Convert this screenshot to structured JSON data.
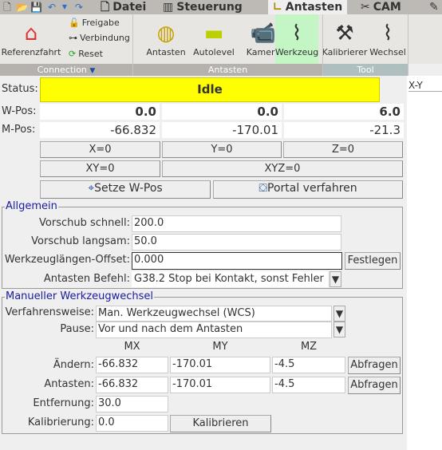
{
  "tabs": [
    {
      "label": "Datei",
      "icon": "document-icon"
    },
    {
      "label": "Steuerung",
      "icon": "sliders-icon"
    },
    {
      "label": "Antasten",
      "icon": "ruler-icon",
      "active": true
    },
    {
      "label": "CAM",
      "icon": "tools-icon"
    }
  ],
  "ribbon": {
    "connection": {
      "group": "Connection",
      "home": "Referenzfahrt",
      "unlock": "Freigabe",
      "connect": "Verbindung",
      "reset": "Reset"
    },
    "probe": {
      "group": "Antasten",
      "probe": "Antasten",
      "autolevel": "Autolevel",
      "camera": "Kamera",
      "tool": "Werkzeug"
    },
    "tool": {
      "group": "Tool",
      "calibrate": "Kalibrierer",
      "change": "Wechsel"
    },
    "active_color": "#c4f5c4"
  },
  "status": {
    "label": "Status:",
    "value": "Idle",
    "color": "#ffff00"
  },
  "wpos": {
    "label": "W-Pos:",
    "x": "0.0",
    "y": "0.0",
    "z": "6.0"
  },
  "mpos": {
    "label": "M-Pos:",
    "x": "-66.832",
    "y": "-170.01",
    "z": "-21.3"
  },
  "zero": {
    "x": "X=0",
    "y": "Y=0",
    "z": "Z=0",
    "xy": "XY=0",
    "xyz": "XYZ=0"
  },
  "actions": {
    "set_wpos": "Setze W-Pos",
    "move_gantry": "Portal verfahren"
  },
  "right_tab": "X-Y",
  "general": {
    "title": "Allgemein",
    "fast_label": "Vorschub schnell:",
    "fast": "200.0",
    "slow_label": "Vorschub langsam:",
    "slow": "50.0",
    "tlo_label": "Werkzeuglängen-Offset:",
    "tlo": "0.000",
    "set": "Festlegen",
    "cmd_label": "Antasten Befehl:",
    "cmd": "G38.2 Stop bei Kontakt, sonst Fehler"
  },
  "toolchange": {
    "title": "Manueller Werkzeugwechsel",
    "policy_label": "Verfahrensweise:",
    "policy": "Man. Werkzeugwechsel (WCS)",
    "pause_label": "Pause:",
    "pause": "Vor und nach dem Antasten",
    "cols": [
      "MX",
      "MY",
      "MZ"
    ],
    "change_label": "Ändern:",
    "change": [
      "-66.832",
      "-170.01",
      "-4.5"
    ],
    "probe_label": "Antasten:",
    "probe": [
      "-66.832",
      "-170.01",
      "-4.5"
    ],
    "get": "Abfragen",
    "dist_label": "Entfernung:",
    "dist": "30.0",
    "cal_label": "Kalibrierung:",
    "cal": "0.0",
    "calibrate": "Kalibrieren"
  }
}
